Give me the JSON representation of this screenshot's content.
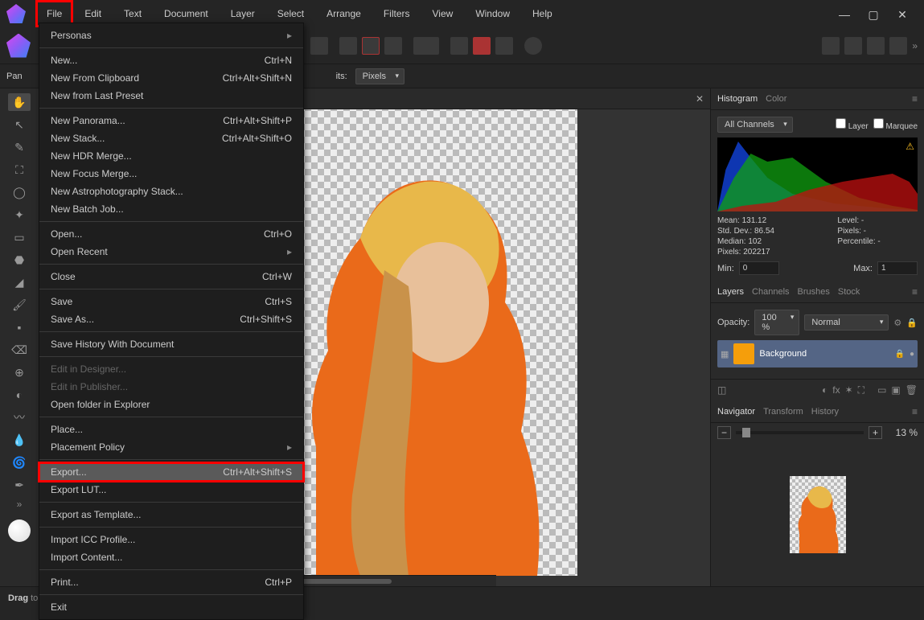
{
  "menubar": {
    "items": [
      "File",
      "Edit",
      "Text",
      "Document",
      "Layer",
      "Select",
      "Arrange",
      "Filters",
      "View",
      "Window",
      "Help"
    ],
    "active_index": 0
  },
  "tool_context_label": "Pan",
  "options_bar": {
    "units_label": "its:",
    "units_value": "Pixels"
  },
  "file_menu": {
    "groups": [
      [
        {
          "label": "Personas",
          "arrow": true
        }
      ],
      [
        {
          "label": "New...",
          "shortcut": "Ctrl+N"
        },
        {
          "label": "New From Clipboard",
          "shortcut": "Ctrl+Alt+Shift+N"
        },
        {
          "label": "New from Last Preset"
        }
      ],
      [
        {
          "label": "New Panorama...",
          "shortcut": "Ctrl+Alt+Shift+P"
        },
        {
          "label": "New Stack...",
          "shortcut": "Ctrl+Alt+Shift+O"
        },
        {
          "label": "New HDR Merge..."
        },
        {
          "label": "New Focus Merge..."
        },
        {
          "label": "New Astrophotography Stack..."
        },
        {
          "label": "New Batch Job..."
        }
      ],
      [
        {
          "label": "Open...",
          "shortcut": "Ctrl+O"
        },
        {
          "label": "Open Recent",
          "arrow": true
        }
      ],
      [
        {
          "label": "Close",
          "shortcut": "Ctrl+W"
        }
      ],
      [
        {
          "label": "Save",
          "shortcut": "Ctrl+S"
        },
        {
          "label": "Save As...",
          "shortcut": "Ctrl+Shift+S"
        }
      ],
      [
        {
          "label": "Save History With Document"
        }
      ],
      [
        {
          "label": "Edit in Designer...",
          "disabled": true
        },
        {
          "label": "Edit in Publisher...",
          "disabled": true
        },
        {
          "label": "Open folder in Explorer"
        }
      ],
      [
        {
          "label": "Place...",
          "shortcut": ""
        },
        {
          "label": "Placement Policy",
          "arrow": true
        }
      ],
      [
        {
          "label": "Export...",
          "shortcut": "Ctrl+Alt+Shift+S",
          "highlighted": true
        },
        {
          "label": "Export LUT..."
        }
      ],
      [
        {
          "label": "Export as Template..."
        }
      ],
      [
        {
          "label": "Import ICC Profile..."
        },
        {
          "label": "Import Content..."
        }
      ],
      [
        {
          "label": "Print...",
          "shortcut": "Ctrl+P"
        }
      ],
      [
        {
          "label": "Exit"
        }
      ]
    ]
  },
  "histogram": {
    "tabs": [
      "Histogram",
      "Color"
    ],
    "active_tab": 0,
    "channel": "All Channels",
    "layer_cb": "Layer",
    "marquee_cb": "Marquee",
    "stats": {
      "mean": "Mean: 131.12",
      "std": "Std. Dev.: 86.54",
      "median": "Median: 102",
      "pixels": "Pixels: 202217",
      "level": "Level: -",
      "pixels2": "Pixels: -",
      "percentile": "Percentile: -"
    },
    "min_label": "Min:",
    "min_val": "0",
    "max_label": "Max:",
    "max_val": "1"
  },
  "layers_panel": {
    "tabs": [
      "Layers",
      "Channels",
      "Brushes",
      "Stock"
    ],
    "active_tab": 0,
    "opacity_label": "Opacity:",
    "opacity_val": "100 %",
    "blend_mode": "Normal",
    "layer": {
      "name": "Background"
    }
  },
  "navigator": {
    "tabs": [
      "Navigator",
      "Transform",
      "History"
    ],
    "active_tab": 0,
    "zoom": "13 %"
  },
  "status": {
    "bold": "Drag",
    "rest": " to pan view."
  }
}
